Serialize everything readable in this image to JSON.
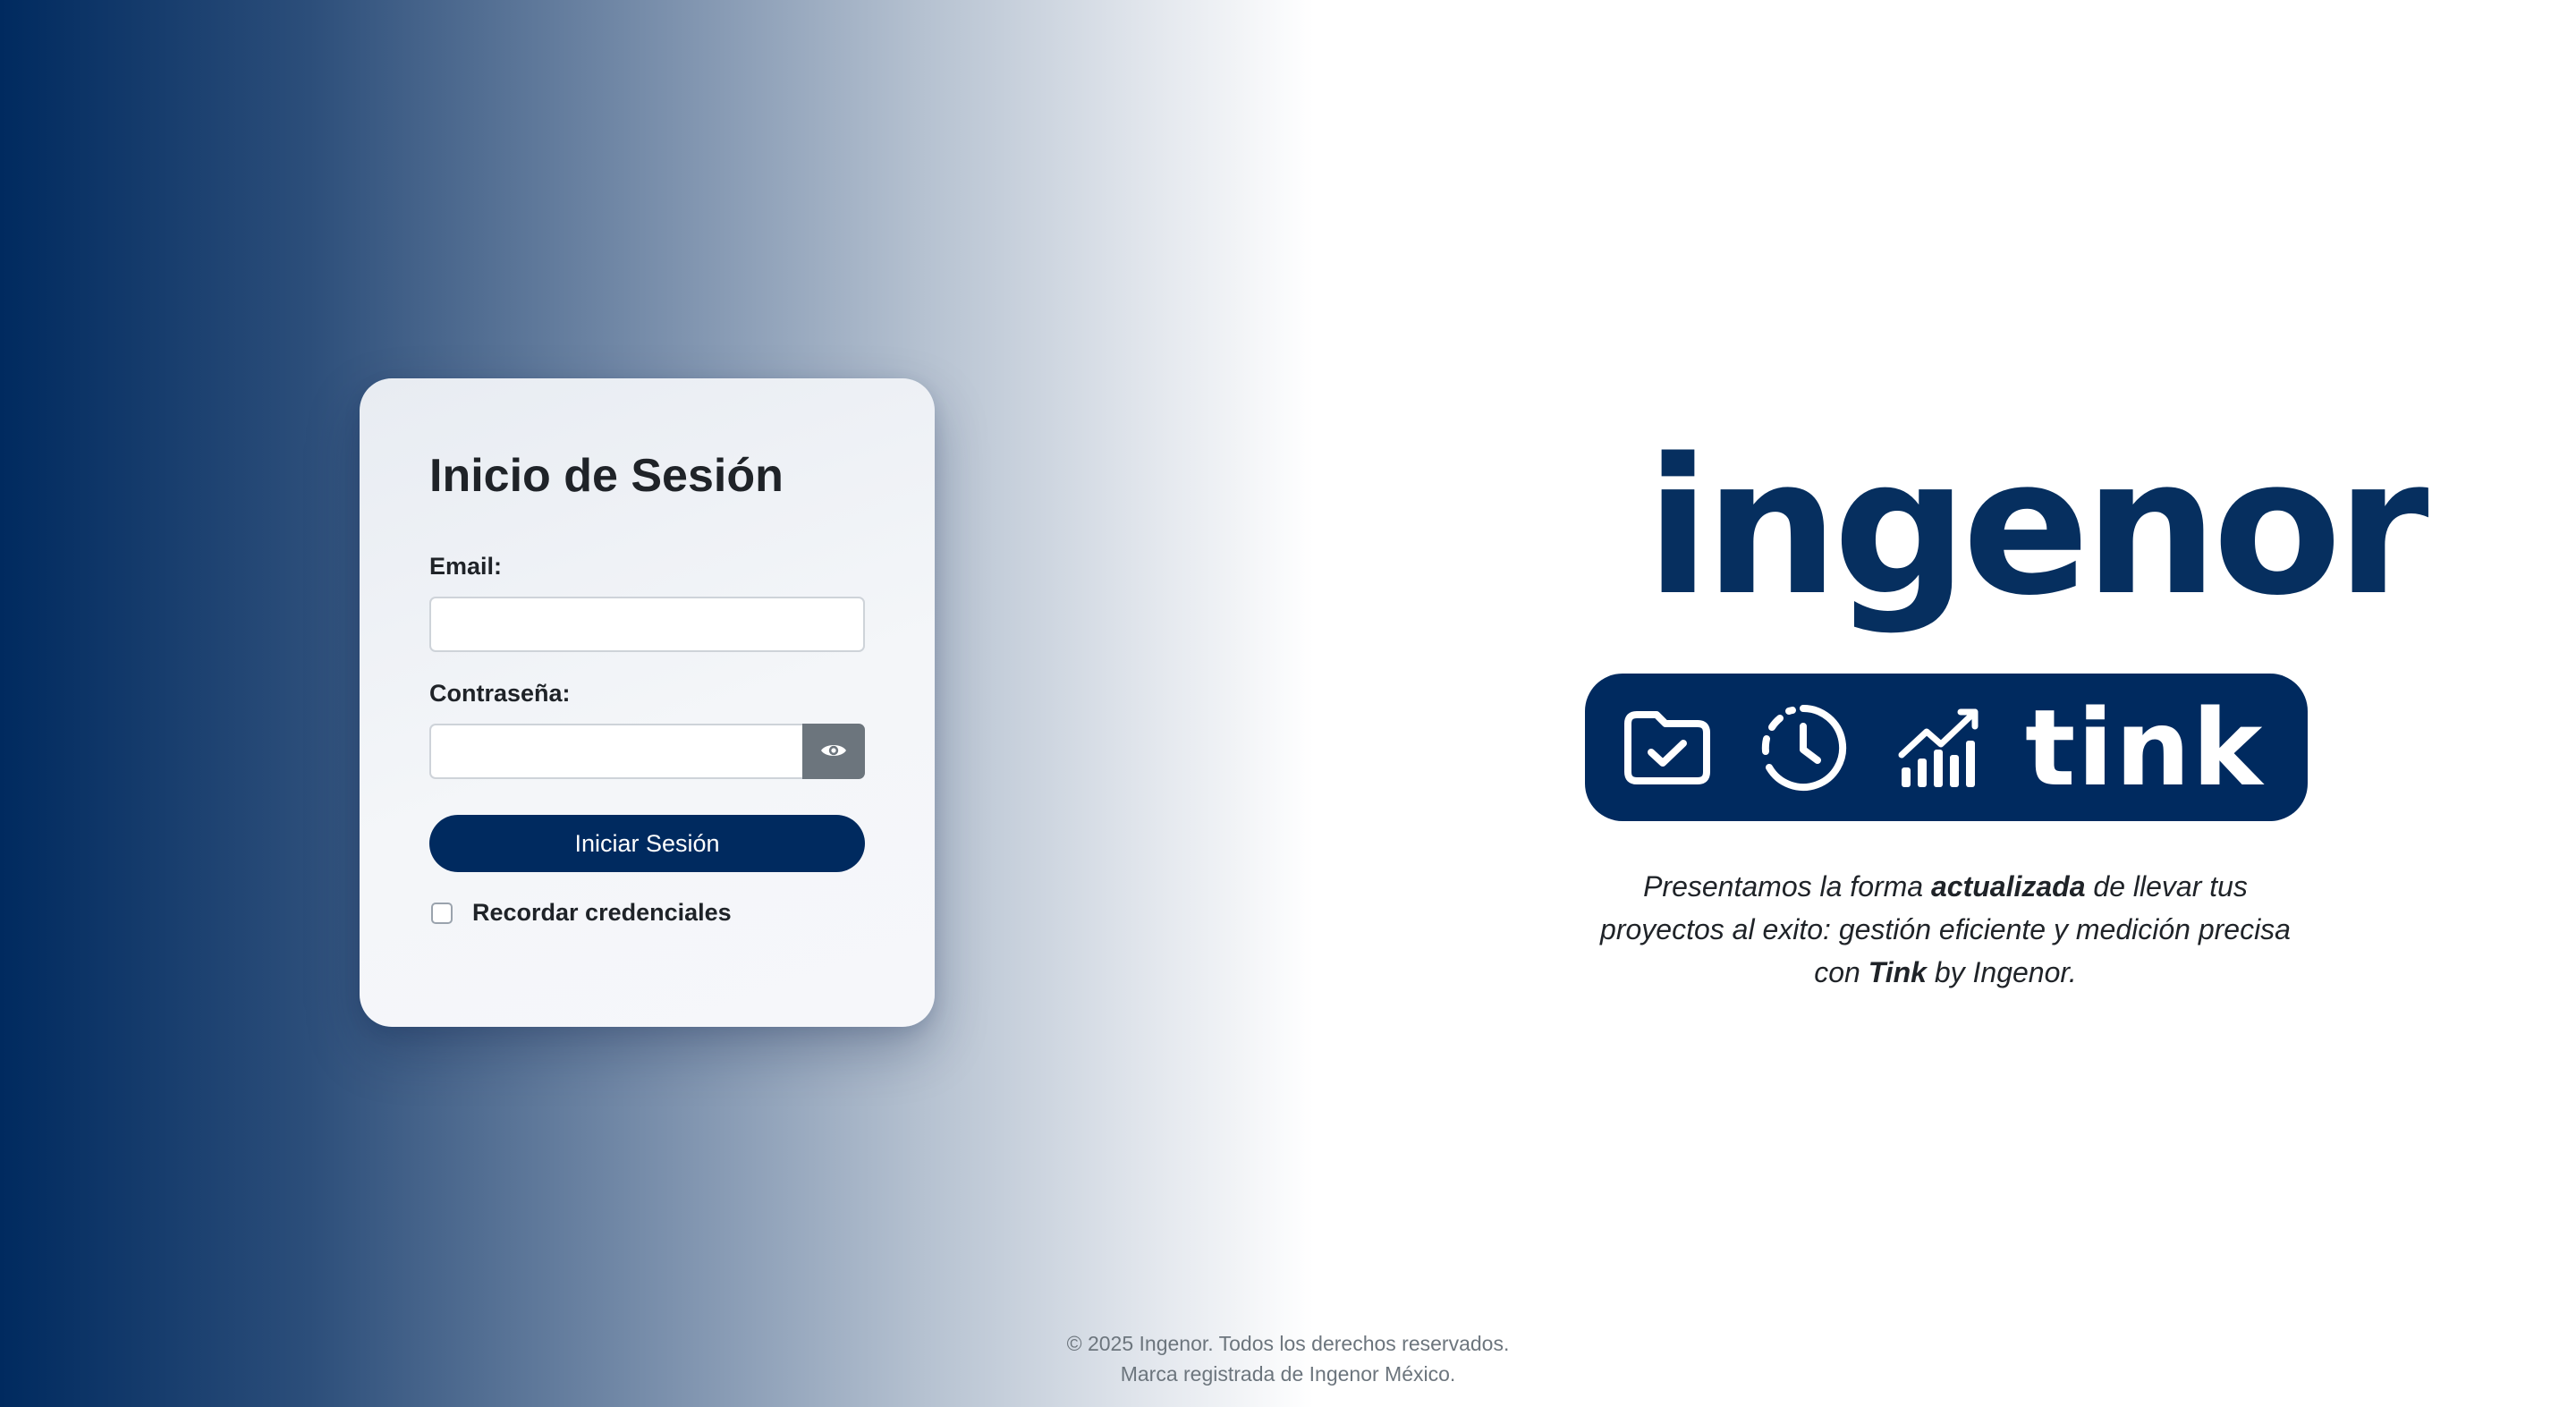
{
  "login": {
    "title": "Inicio de Sesión",
    "email_label": "Email:",
    "email_value": "",
    "email_placeholder": "",
    "password_label": "Contraseña:",
    "password_value": "",
    "password_placeholder": "",
    "toggle_password_icon": "eye-icon",
    "submit_label": "Iniciar Sesión",
    "remember_label": "Recordar credenciales",
    "remember_checked": false
  },
  "brand": {
    "logo_text": "ingenor",
    "banner_icons": [
      "folder-check-icon",
      "clock-icon",
      "chart-growth-icon"
    ],
    "banner_word": "tink",
    "tagline": {
      "part1": "Presentamos la forma ",
      "bold1": "actualizada",
      "part2": " de llevar tus proyectos al exito: gestión eficiente y medición precisa con ",
      "bold2": "Tink",
      "part3": " by Ingenor."
    }
  },
  "footer": {
    "line1": "© 2025 Ingenor. Todos los derechos reservados.",
    "line2": "Marca registrada de Ingenor México."
  },
  "colors": {
    "brand_navy": "#002a5f",
    "logo_navy": "#062f5f",
    "eye_button_gray": "#6c757d",
    "text_dark": "#1f2328",
    "footer_gray": "#6c757d"
  }
}
